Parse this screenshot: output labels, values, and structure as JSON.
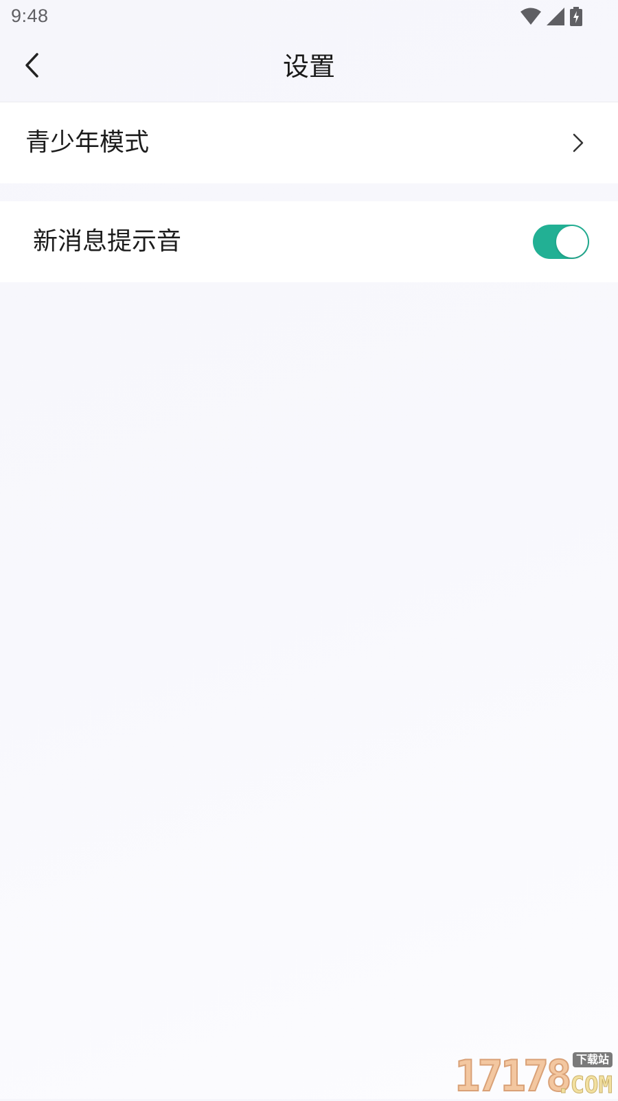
{
  "status_bar": {
    "time": "9:48",
    "icons": [
      "wifi-icon",
      "signal-icon",
      "battery-charging-icon"
    ]
  },
  "header": {
    "title": "设置",
    "back_icon": "chevron-left-icon"
  },
  "settings": {
    "items": [
      {
        "label": "青少年模式",
        "type": "link",
        "icon": "chevron-right-icon"
      },
      {
        "label": "新消息提示音",
        "type": "toggle",
        "enabled": true
      }
    ]
  },
  "watermark": {
    "digits": "17178",
    "badge": "下载站",
    "suffix": ".COM"
  },
  "colors": {
    "accent": "#22b094",
    "background": "#f7f7fc",
    "row_background": "#ffffff",
    "text": "#1c1c1c"
  }
}
